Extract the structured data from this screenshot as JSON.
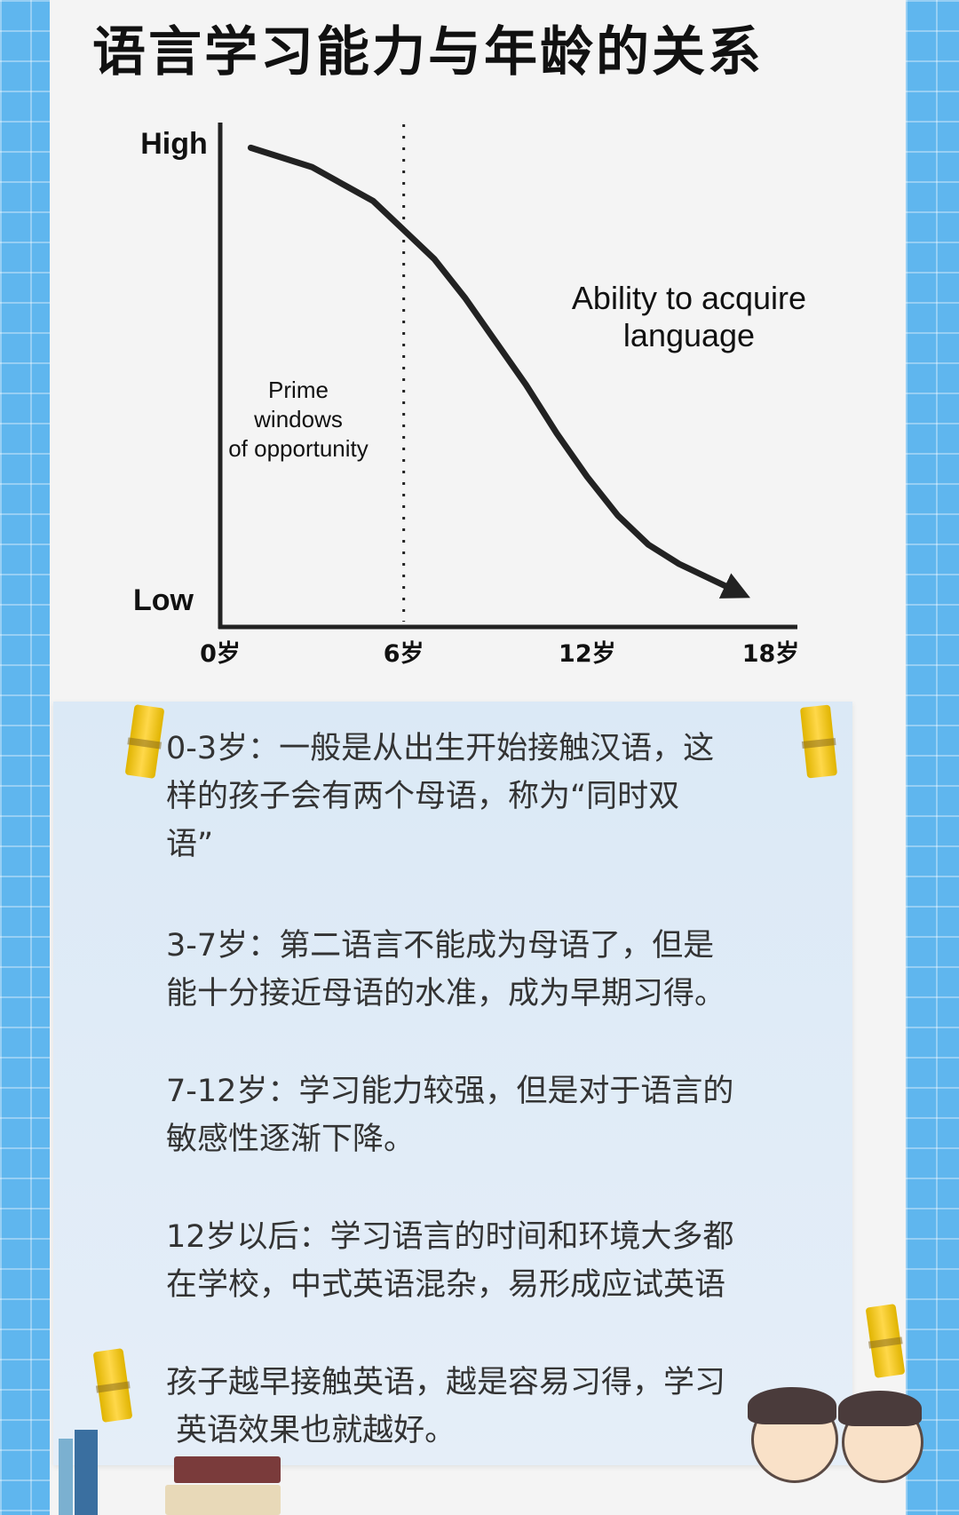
{
  "title": "语言学习能力与年龄的关系",
  "chart_data": {
    "type": "line",
    "x_tick_labels": [
      "0岁",
      "6岁",
      "12岁",
      "18岁"
    ],
    "x_ticks": [
      0,
      6,
      12,
      18
    ],
    "y_tick_labels": [
      "High",
      "Low"
    ],
    "xlim": [
      0,
      18
    ],
    "ylim": [
      0,
      1
    ],
    "series": [
      {
        "name": "Ability to acquire language",
        "x": [
          1,
          3,
          5,
          6,
          7,
          8,
          9,
          10,
          11,
          12,
          13,
          14,
          15,
          16,
          17
        ],
        "y": [
          0.97,
          0.93,
          0.86,
          0.8,
          0.74,
          0.66,
          0.57,
          0.48,
          0.38,
          0.29,
          0.21,
          0.15,
          0.11,
          0.08,
          0.05
        ]
      }
    ],
    "marker_line": {
      "x": 6,
      "style": "dotted"
    },
    "annotation": {
      "lines": [
        "Prime",
        "windows",
        "of opportunity"
      ]
    },
    "line_color": "#222222"
  },
  "paragraphs": [
    {
      "lines": [
        "0-3岁：一般是从出生开始接触汉语，这",
        "样的孩子会有两个母语，称为“同时双",
        "语”"
      ]
    },
    {
      "lines": [
        "3-7岁：第二语言不能成为母语了，但是",
        "能十分接近母语的水准，成为早期习得。"
      ]
    },
    {
      "lines": [
        "7-12岁：学习能力较强，但是对于语言的",
        "敏感性逐渐下降。"
      ]
    },
    {
      "lines": [
        "12岁以后：学习语言的时间和环境大多都",
        "在学校，中式英语混杂，易形成应试英语"
      ]
    },
    {
      "lines": [
        "孩子越早接触英语，越是容易习得，学习",
        " 英语效果也就越好。"
      ]
    }
  ]
}
